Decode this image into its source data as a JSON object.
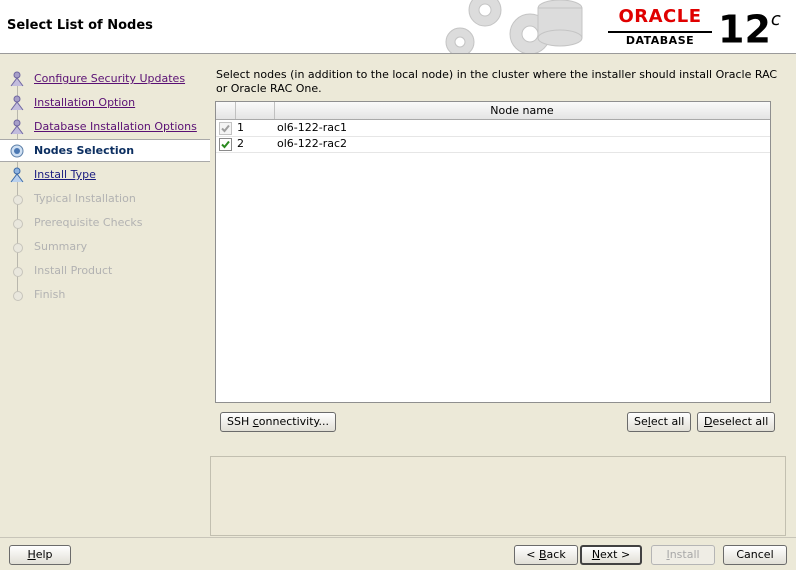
{
  "window": {
    "title": "Select List of Nodes"
  },
  "brand": {
    "oracle": "ORACLE",
    "database": "DATABASE",
    "version_number": "12",
    "version_suffix": "c"
  },
  "steps": [
    {
      "label": "Configure Security Updates",
      "state": "done"
    },
    {
      "label": "Installation Option",
      "state": "done"
    },
    {
      "label": "Database Installation Options",
      "state": "done"
    },
    {
      "label": "Nodes Selection",
      "state": "current"
    },
    {
      "label": "Install Type",
      "state": "link"
    },
    {
      "label": "Typical Installation",
      "state": "future"
    },
    {
      "label": "Prerequisite Checks",
      "state": "future"
    },
    {
      "label": "Summary",
      "state": "future"
    },
    {
      "label": "Install Product",
      "state": "future"
    },
    {
      "label": "Finish",
      "state": "future"
    }
  ],
  "content": {
    "instruction": "Select nodes (in addition to the local node) in the cluster where the installer should install Oracle RAC or Oracle RAC One.",
    "table": {
      "columns": [
        "",
        "",
        "Node name"
      ],
      "rows": [
        {
          "checked": true,
          "enabled": false,
          "index": "1",
          "node": "ol6-122-rac1"
        },
        {
          "checked": true,
          "enabled": true,
          "index": "2",
          "node": "ol6-122-rac2"
        }
      ]
    },
    "buttons": {
      "ssh_pre": "SSH ",
      "ssh_key": "c",
      "ssh_post": "onnectivity...",
      "select_all_pre": "Se",
      "select_all_key": "l",
      "select_all_post": "ect all",
      "deselect_all_key": "D",
      "deselect_all_post": "eselect all"
    }
  },
  "footer": {
    "help_key": "H",
    "help_post": "elp",
    "back_pre": "< ",
    "back_key": "B",
    "back_post": "ack",
    "next_key": "N",
    "next_post": "ext >",
    "install_key": "I",
    "install_post": "nstall",
    "cancel": "Cancel"
  }
}
